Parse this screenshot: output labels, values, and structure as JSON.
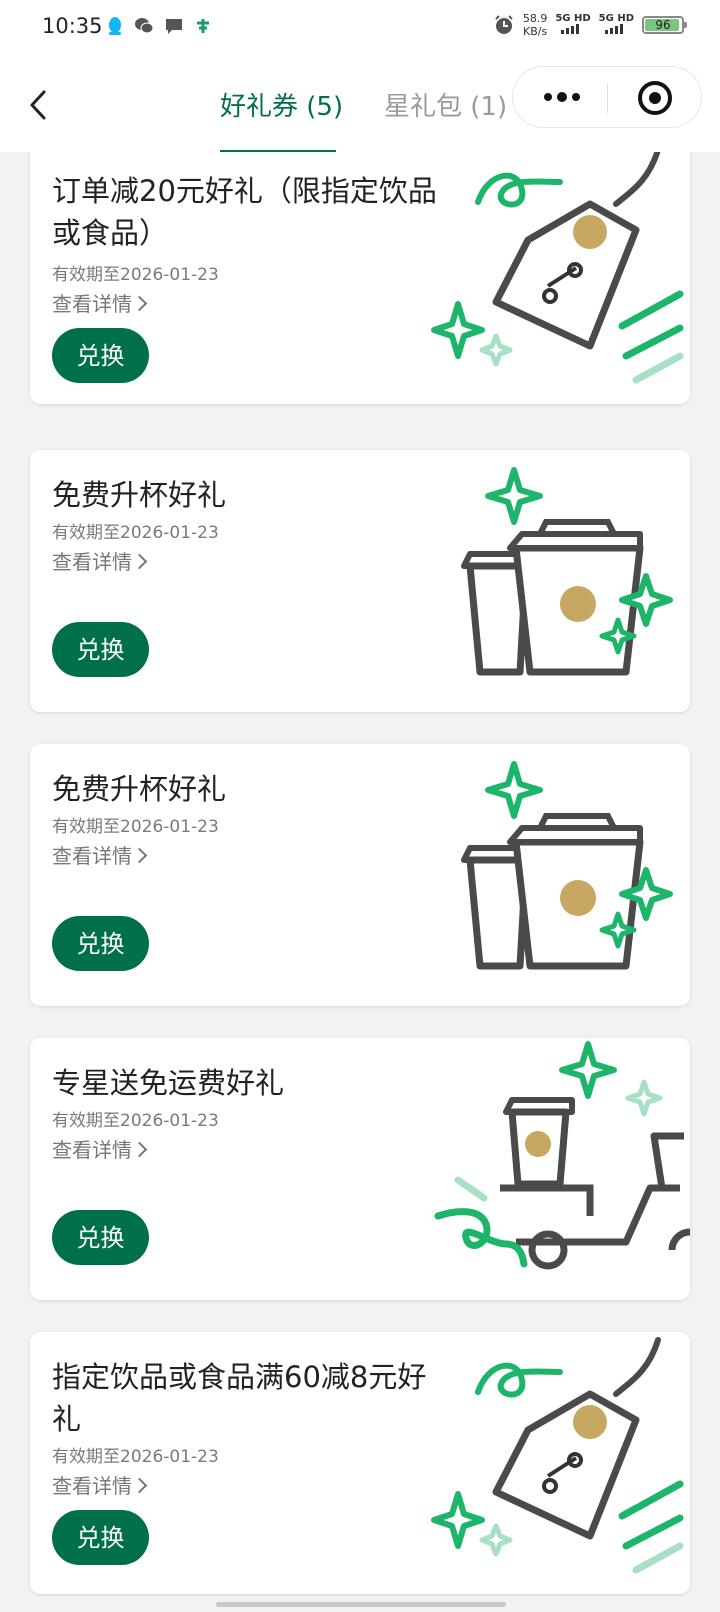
{
  "status_bar": {
    "time": "10:35",
    "net_speed_value": "58.9",
    "net_speed_unit": "KB/s",
    "signal_1": "5G HD",
    "signal_2": "5G HD",
    "battery": "96"
  },
  "nav": {
    "tabs": [
      {
        "label": "好礼券 (5)",
        "active": true
      },
      {
        "label": "星礼包 (1)",
        "active": false
      }
    ]
  },
  "coupons": [
    {
      "title": "订单减20元好礼（限指定饮品或食品）",
      "validity": "有效期至2026-01-23",
      "details": "查看详情",
      "button": "兑换",
      "art": "discount-tag"
    },
    {
      "title": "免费升杯好礼",
      "validity": "有效期至2026-01-23",
      "details": "查看详情",
      "button": "兑换",
      "art": "cup-upgrade"
    },
    {
      "title": "免费升杯好礼",
      "validity": "有效期至2026-01-23",
      "details": "查看详情",
      "button": "兑换",
      "art": "cup-upgrade"
    },
    {
      "title": "专星送免运费好礼",
      "validity": "有效期至2026-01-23",
      "details": "查看详情",
      "button": "兑换",
      "art": "delivery-scooter"
    },
    {
      "title": "指定饮品或食品满60减8元好礼",
      "validity": "有效期至2026-01-23",
      "details": "查看详情",
      "button": "兑换",
      "art": "discount-tag"
    }
  ],
  "colors": {
    "brand_green": "#00704a",
    "accent_green": "#1db56a",
    "gold": "#c7a862",
    "tab_inactive": "#9a9a9a"
  }
}
